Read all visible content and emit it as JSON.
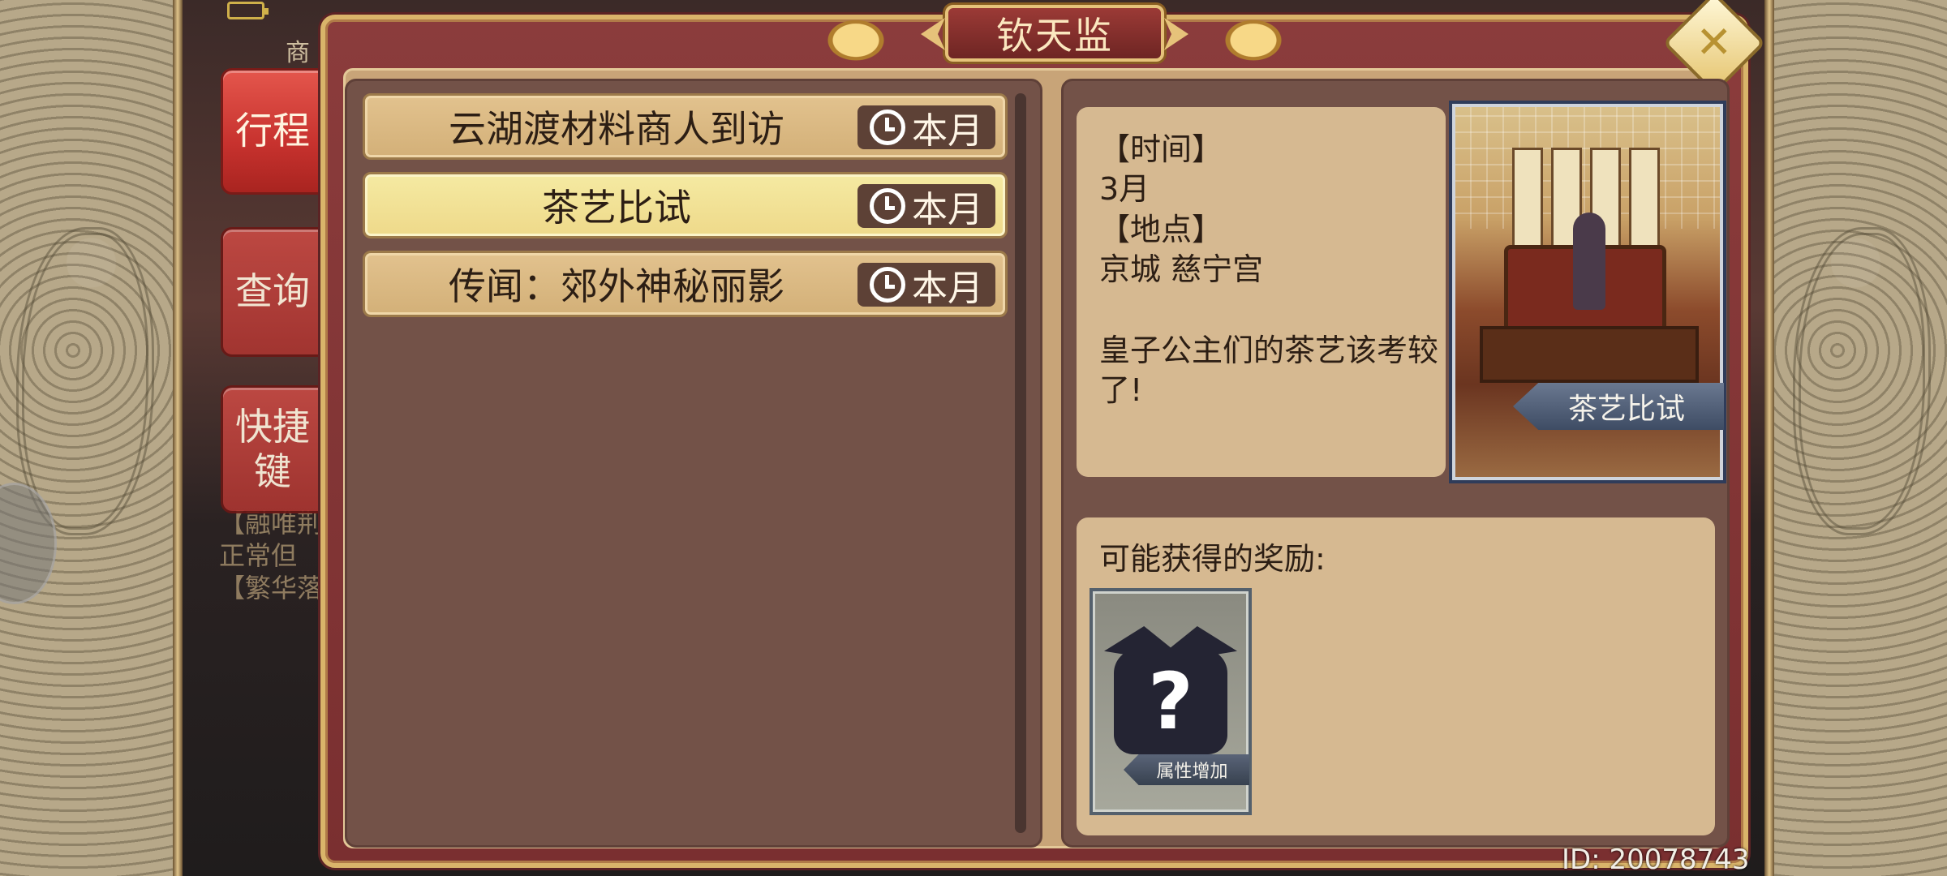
{
  "dialog": {
    "title": "钦天监",
    "close_label": "✕"
  },
  "side_tabs": [
    {
      "label": "行程",
      "active": true
    },
    {
      "label": "查询",
      "active": false
    },
    {
      "label": "快捷\n键",
      "active": false
    }
  ],
  "events": [
    {
      "label": "云湖渡材料商人到访",
      "badge": "本月",
      "selected": false
    },
    {
      "label": "茶艺比试",
      "badge": "本月",
      "selected": true
    },
    {
      "label": "传闻：郊外神秘丽影",
      "badge": "本月",
      "selected": false
    }
  ],
  "detail": {
    "time_header": "【时间】",
    "time_value": "3月",
    "place_header": "【地点】",
    "place_value": "京城 慈宁宫",
    "description": "皇子公主们的茶艺该考较了!",
    "image_caption": "茶艺比试"
  },
  "rewards": {
    "title": "可能获得的奖励:",
    "items": [
      {
        "icon": "mystery-bag-icon",
        "symbol": "?",
        "caption": "属性增加"
      }
    ]
  },
  "background_fragments": {
    "tab_text": "商",
    "text_1": "【融唯荆",
    "text_2": "正常但",
    "text_3": "【繁华落"
  },
  "footer": {
    "user_id": "ID: 20078743"
  },
  "colors": {
    "accent_red": "#c7322e",
    "frame_gold": "#d9b46a",
    "selected_item": "#f5eaa2",
    "panel_brown": "#735248"
  }
}
